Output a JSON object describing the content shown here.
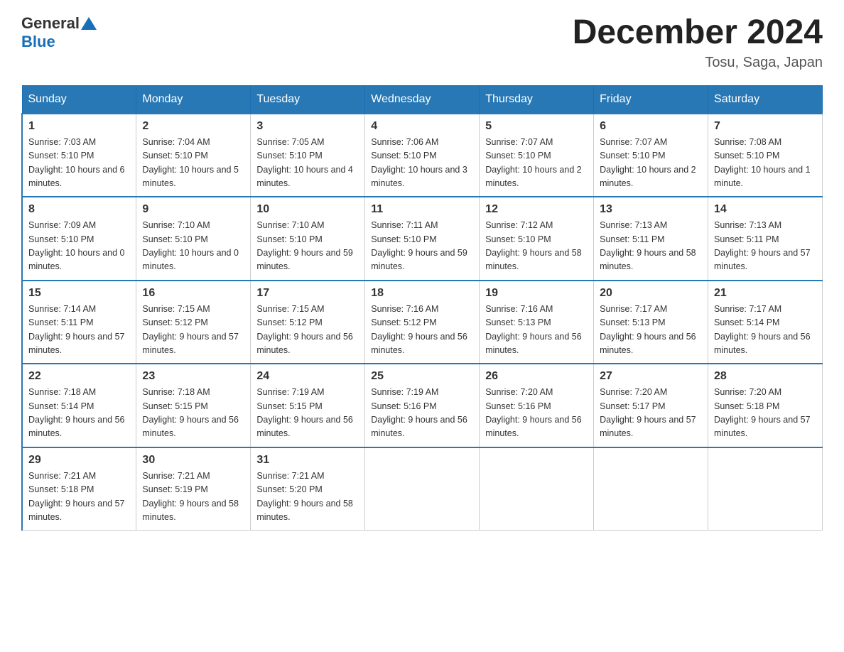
{
  "header": {
    "logo_general": "General",
    "logo_blue": "Blue",
    "month_year": "December 2024",
    "location": "Tosu, Saga, Japan"
  },
  "days_of_week": [
    "Sunday",
    "Monday",
    "Tuesday",
    "Wednesday",
    "Thursday",
    "Friday",
    "Saturday"
  ],
  "weeks": [
    [
      {
        "day": "1",
        "sunrise": "7:03 AM",
        "sunset": "5:10 PM",
        "daylight": "10 hours and 6 minutes."
      },
      {
        "day": "2",
        "sunrise": "7:04 AM",
        "sunset": "5:10 PM",
        "daylight": "10 hours and 5 minutes."
      },
      {
        "day": "3",
        "sunrise": "7:05 AM",
        "sunset": "5:10 PM",
        "daylight": "10 hours and 4 minutes."
      },
      {
        "day": "4",
        "sunrise": "7:06 AM",
        "sunset": "5:10 PM",
        "daylight": "10 hours and 3 minutes."
      },
      {
        "day": "5",
        "sunrise": "7:07 AM",
        "sunset": "5:10 PM",
        "daylight": "10 hours and 2 minutes."
      },
      {
        "day": "6",
        "sunrise": "7:07 AM",
        "sunset": "5:10 PM",
        "daylight": "10 hours and 2 minutes."
      },
      {
        "day": "7",
        "sunrise": "7:08 AM",
        "sunset": "5:10 PM",
        "daylight": "10 hours and 1 minute."
      }
    ],
    [
      {
        "day": "8",
        "sunrise": "7:09 AM",
        "sunset": "5:10 PM",
        "daylight": "10 hours and 0 minutes."
      },
      {
        "day": "9",
        "sunrise": "7:10 AM",
        "sunset": "5:10 PM",
        "daylight": "10 hours and 0 minutes."
      },
      {
        "day": "10",
        "sunrise": "7:10 AM",
        "sunset": "5:10 PM",
        "daylight": "9 hours and 59 minutes."
      },
      {
        "day": "11",
        "sunrise": "7:11 AM",
        "sunset": "5:10 PM",
        "daylight": "9 hours and 59 minutes."
      },
      {
        "day": "12",
        "sunrise": "7:12 AM",
        "sunset": "5:10 PM",
        "daylight": "9 hours and 58 minutes."
      },
      {
        "day": "13",
        "sunrise": "7:13 AM",
        "sunset": "5:11 PM",
        "daylight": "9 hours and 58 minutes."
      },
      {
        "day": "14",
        "sunrise": "7:13 AM",
        "sunset": "5:11 PM",
        "daylight": "9 hours and 57 minutes."
      }
    ],
    [
      {
        "day": "15",
        "sunrise": "7:14 AM",
        "sunset": "5:11 PM",
        "daylight": "9 hours and 57 minutes."
      },
      {
        "day": "16",
        "sunrise": "7:15 AM",
        "sunset": "5:12 PM",
        "daylight": "9 hours and 57 minutes."
      },
      {
        "day": "17",
        "sunrise": "7:15 AM",
        "sunset": "5:12 PM",
        "daylight": "9 hours and 56 minutes."
      },
      {
        "day": "18",
        "sunrise": "7:16 AM",
        "sunset": "5:12 PM",
        "daylight": "9 hours and 56 minutes."
      },
      {
        "day": "19",
        "sunrise": "7:16 AM",
        "sunset": "5:13 PM",
        "daylight": "9 hours and 56 minutes."
      },
      {
        "day": "20",
        "sunrise": "7:17 AM",
        "sunset": "5:13 PM",
        "daylight": "9 hours and 56 minutes."
      },
      {
        "day": "21",
        "sunrise": "7:17 AM",
        "sunset": "5:14 PM",
        "daylight": "9 hours and 56 minutes."
      }
    ],
    [
      {
        "day": "22",
        "sunrise": "7:18 AM",
        "sunset": "5:14 PM",
        "daylight": "9 hours and 56 minutes."
      },
      {
        "day": "23",
        "sunrise": "7:18 AM",
        "sunset": "5:15 PM",
        "daylight": "9 hours and 56 minutes."
      },
      {
        "day": "24",
        "sunrise": "7:19 AM",
        "sunset": "5:15 PM",
        "daylight": "9 hours and 56 minutes."
      },
      {
        "day": "25",
        "sunrise": "7:19 AM",
        "sunset": "5:16 PM",
        "daylight": "9 hours and 56 minutes."
      },
      {
        "day": "26",
        "sunrise": "7:20 AM",
        "sunset": "5:16 PM",
        "daylight": "9 hours and 56 minutes."
      },
      {
        "day": "27",
        "sunrise": "7:20 AM",
        "sunset": "5:17 PM",
        "daylight": "9 hours and 57 minutes."
      },
      {
        "day": "28",
        "sunrise": "7:20 AM",
        "sunset": "5:18 PM",
        "daylight": "9 hours and 57 minutes."
      }
    ],
    [
      {
        "day": "29",
        "sunrise": "7:21 AM",
        "sunset": "5:18 PM",
        "daylight": "9 hours and 57 minutes."
      },
      {
        "day": "30",
        "sunrise": "7:21 AM",
        "sunset": "5:19 PM",
        "daylight": "9 hours and 58 minutes."
      },
      {
        "day": "31",
        "sunrise": "7:21 AM",
        "sunset": "5:20 PM",
        "daylight": "9 hours and 58 minutes."
      },
      null,
      null,
      null,
      null
    ]
  ],
  "labels": {
    "sunrise": "Sunrise:",
    "sunset": "Sunset:",
    "daylight": "Daylight:"
  }
}
